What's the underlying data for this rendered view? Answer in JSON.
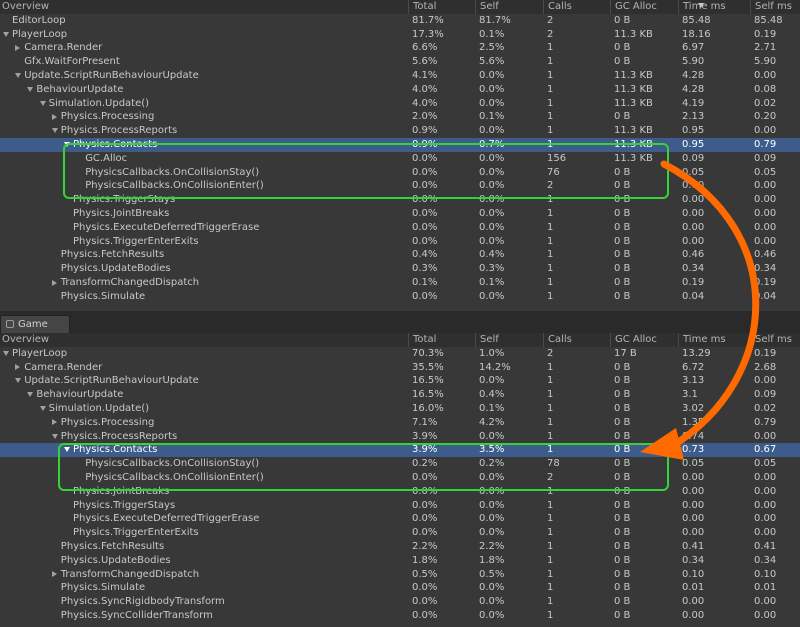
{
  "columns": {
    "name": "Overview",
    "total": "Total",
    "self": "Self",
    "calls": "Calls",
    "gc": "GC Alloc",
    "time": "Time ms",
    "selfms": "Self ms"
  },
  "tab": {
    "label": "Game"
  },
  "colors": {
    "highlight": "#35d335",
    "arrow": "#ff6a00",
    "selected": "#3d5c8c"
  },
  "top_rows": [
    {
      "name": "EditorLoop",
      "depth": 0,
      "expand": "none",
      "total": "81.7%",
      "self": "81.7%",
      "calls": "2",
      "gc": "0 B",
      "time": "85.48",
      "selfms": "85.48"
    },
    {
      "name": "PlayerLoop",
      "depth": 0,
      "expand": "open",
      "total": "17.3%",
      "self": "0.1%",
      "calls": "2",
      "gc": "11.3 KB",
      "time": "18.16",
      "selfms": "0.19"
    },
    {
      "name": "Camera.Render",
      "depth": 1,
      "expand": "closed",
      "total": "6.6%",
      "self": "2.5%",
      "calls": "1",
      "gc": "0 B",
      "time": "6.97",
      "selfms": "2.71"
    },
    {
      "name": "Gfx.WaitForPresent",
      "depth": 1,
      "expand": "none",
      "total": "5.6%",
      "self": "5.6%",
      "calls": "1",
      "gc": "0 B",
      "time": "5.90",
      "selfms": "5.90"
    },
    {
      "name": "Update.ScriptRunBehaviourUpdate",
      "depth": 1,
      "expand": "open",
      "total": "4.1%",
      "self": "0.0%",
      "calls": "1",
      "gc": "11.3 KB",
      "time": "4.28",
      "selfms": "0.00"
    },
    {
      "name": "BehaviourUpdate",
      "depth": 2,
      "expand": "open",
      "total": "4.0%",
      "self": "0.0%",
      "calls": "1",
      "gc": "11.3 KB",
      "time": "4.28",
      "selfms": "0.08"
    },
    {
      "name": "Simulation.Update()",
      "depth": 3,
      "expand": "open",
      "total": "4.0%",
      "self": "0.0%",
      "calls": "1",
      "gc": "11.3 KB",
      "time": "4.19",
      "selfms": "0.02"
    },
    {
      "name": "Physics.Processing",
      "depth": 4,
      "expand": "closed",
      "total": "2.0%",
      "self": "0.1%",
      "calls": "1",
      "gc": "0 B",
      "time": "2.13",
      "selfms": "0.20"
    },
    {
      "name": "Physics.ProcessReports",
      "depth": 4,
      "expand": "open",
      "total": "0.9%",
      "self": "0.0%",
      "calls": "1",
      "gc": "11.3 KB",
      "time": "0.95",
      "selfms": "0.00"
    },
    {
      "name": "Physics.Contacts",
      "depth": 5,
      "expand": "open",
      "total": "0.9%",
      "self": "0.7%",
      "calls": "1",
      "gc": "11.3 KB",
      "time": "0.95",
      "selfms": "0.79",
      "selected": true
    },
    {
      "name": "GC.Alloc",
      "depth": 6,
      "expand": "none",
      "total": "0.0%",
      "self": "0.0%",
      "calls": "156",
      "gc": "11.3 KB",
      "time": "0.09",
      "selfms": "0.09"
    },
    {
      "name": "PhysicsCallbacks.OnCollisionStay()",
      "depth": 6,
      "expand": "none",
      "total": "0.0%",
      "self": "0.0%",
      "calls": "76",
      "gc": "0 B",
      "time": "0.05",
      "selfms": "0.05"
    },
    {
      "name": "PhysicsCallbacks.OnCollisionEnter()",
      "depth": 6,
      "expand": "none",
      "total": "0.0%",
      "self": "0.0%",
      "calls": "2",
      "gc": "0 B",
      "time": "0.00",
      "selfms": "0.00"
    },
    {
      "name": "Physics.TriggerStays",
      "depth": 5,
      "expand": "none",
      "total": "0.0%",
      "self": "0.0%",
      "calls": "1",
      "gc": "0 B",
      "time": "0.00",
      "selfms": "0.00"
    },
    {
      "name": "Physics.JointBreaks",
      "depth": 5,
      "expand": "none",
      "total": "0.0%",
      "self": "0.0%",
      "calls": "1",
      "gc": "0 B",
      "time": "0.00",
      "selfms": "0.00"
    },
    {
      "name": "Physics.ExecuteDeferredTriggerErase",
      "depth": 5,
      "expand": "none",
      "total": "0.0%",
      "self": "0.0%",
      "calls": "1",
      "gc": "0 B",
      "time": "0.00",
      "selfms": "0.00"
    },
    {
      "name": "Physics.TriggerEnterExits",
      "depth": 5,
      "expand": "none",
      "total": "0.0%",
      "self": "0.0%",
      "calls": "1",
      "gc": "0 B",
      "time": "0.00",
      "selfms": "0.00"
    },
    {
      "name": "Physics.FetchResults",
      "depth": 4,
      "expand": "none",
      "total": "0.4%",
      "self": "0.4%",
      "calls": "1",
      "gc": "0 B",
      "time": "0.46",
      "selfms": "0.46"
    },
    {
      "name": "Physics.UpdateBodies",
      "depth": 4,
      "expand": "none",
      "total": "0.3%",
      "self": "0.3%",
      "calls": "1",
      "gc": "0 B",
      "time": "0.34",
      "selfms": "0.34"
    },
    {
      "name": "TransformChangedDispatch",
      "depth": 4,
      "expand": "closed",
      "total": "0.1%",
      "self": "0.1%",
      "calls": "1",
      "gc": "0 B",
      "time": "0.19",
      "selfms": "0.19"
    },
    {
      "name": "Physics.Simulate",
      "depth": 4,
      "expand": "none",
      "total": "0.0%",
      "self": "0.0%",
      "calls": "1",
      "gc": "0 B",
      "time": "0.04",
      "selfms": "0.04"
    }
  ],
  "bottom_rows": [
    {
      "name": "PlayerLoop",
      "depth": 0,
      "expand": "open",
      "total": "70.3%",
      "self": "1.0%",
      "calls": "2",
      "gc": "17 B",
      "time": "13.29",
      "selfms": "0.19"
    },
    {
      "name": "Camera.Render",
      "depth": 1,
      "expand": "closed",
      "total": "35.5%",
      "self": "14.2%",
      "calls": "1",
      "gc": "0 B",
      "time": "6.72",
      "selfms": "2.68"
    },
    {
      "name": "Update.ScriptRunBehaviourUpdate",
      "depth": 1,
      "expand": "open",
      "total": "16.5%",
      "self": "0.0%",
      "calls": "1",
      "gc": "0 B",
      "time": "3.13",
      "selfms": "0.00"
    },
    {
      "name": "BehaviourUpdate",
      "depth": 2,
      "expand": "open",
      "total": "16.5%",
      "self": "0.4%",
      "calls": "1",
      "gc": "0 B",
      "time": "3.1",
      "selfms": "0.09"
    },
    {
      "name": "Simulation.Update()",
      "depth": 3,
      "expand": "open",
      "total": "16.0%",
      "self": "0.1%",
      "calls": "1",
      "gc": "0 B",
      "time": "3.02",
      "selfms": "0.02"
    },
    {
      "name": "Physics.Processing",
      "depth": 4,
      "expand": "closed",
      "total": "7.1%",
      "self": "4.2%",
      "calls": "1",
      "gc": "0 B",
      "time": "1.35",
      "selfms": "0.79"
    },
    {
      "name": "Physics.ProcessReports",
      "depth": 4,
      "expand": "open",
      "total": "3.9%",
      "self": "0.0%",
      "calls": "1",
      "gc": "0 B",
      "time": "0.74",
      "selfms": "0.00"
    },
    {
      "name": "Physics.Contacts",
      "depth": 5,
      "expand": "open",
      "total": "3.9%",
      "self": "3.5%",
      "calls": "1",
      "gc": "0 B",
      "time": "0.73",
      "selfms": "0.67",
      "selected": true
    },
    {
      "name": "PhysicsCallbacks.OnCollisionStay()",
      "depth": 6,
      "expand": "none",
      "total": "0.2%",
      "self": "0.2%",
      "calls": "78",
      "gc": "0 B",
      "time": "0.05",
      "selfms": "0.05"
    },
    {
      "name": "PhysicsCallbacks.OnCollisionEnter()",
      "depth": 6,
      "expand": "none",
      "total": "0.0%",
      "self": "0.0%",
      "calls": "2",
      "gc": "0 B",
      "time": "0.00",
      "selfms": "0.00"
    },
    {
      "name": "Physics.JointBreaks",
      "depth": 5,
      "expand": "none",
      "total": "0.0%",
      "self": "0.0%",
      "calls": "1",
      "gc": "0 B",
      "time": "0.00",
      "selfms": "0.00"
    },
    {
      "name": "Physics.TriggerStays",
      "depth": 5,
      "expand": "none",
      "total": "0.0%",
      "self": "0.0%",
      "calls": "1",
      "gc": "0 B",
      "time": "0.00",
      "selfms": "0.00"
    },
    {
      "name": "Physics.ExecuteDeferredTriggerErase",
      "depth": 5,
      "expand": "none",
      "total": "0.0%",
      "self": "0.0%",
      "calls": "1",
      "gc": "0 B",
      "time": "0.00",
      "selfms": "0.00"
    },
    {
      "name": "Physics.TriggerEnterExits",
      "depth": 5,
      "expand": "none",
      "total": "0.0%",
      "self": "0.0%",
      "calls": "1",
      "gc": "0 B",
      "time": "0.00",
      "selfms": "0.00"
    },
    {
      "name": "Physics.FetchResults",
      "depth": 4,
      "expand": "none",
      "total": "2.2%",
      "self": "2.2%",
      "calls": "1",
      "gc": "0 B",
      "time": "0.41",
      "selfms": "0.41"
    },
    {
      "name": "Physics.UpdateBodies",
      "depth": 4,
      "expand": "none",
      "total": "1.8%",
      "self": "1.8%",
      "calls": "1",
      "gc": "0 B",
      "time": "0.34",
      "selfms": "0.34"
    },
    {
      "name": "TransformChangedDispatch",
      "depth": 4,
      "expand": "closed",
      "total": "0.5%",
      "self": "0.5%",
      "calls": "1",
      "gc": "0 B",
      "time": "0.10",
      "selfms": "0.10"
    },
    {
      "name": "Physics.Simulate",
      "depth": 4,
      "expand": "none",
      "total": "0.0%",
      "self": "0.0%",
      "calls": "1",
      "gc": "0 B",
      "time": "0.01",
      "selfms": "0.01"
    },
    {
      "name": "Physics.SyncRigidbodyTransform",
      "depth": 4,
      "expand": "none",
      "total": "0.0%",
      "self": "0.0%",
      "calls": "1",
      "gc": "0 B",
      "time": "0.00",
      "selfms": "0.00"
    },
    {
      "name": "Physics.SyncColliderTransform",
      "depth": 4,
      "expand": "none",
      "total": "0.0%",
      "self": "0.0%",
      "calls": "1",
      "gc": "0 B",
      "time": "0.00",
      "selfms": "0.00"
    }
  ]
}
